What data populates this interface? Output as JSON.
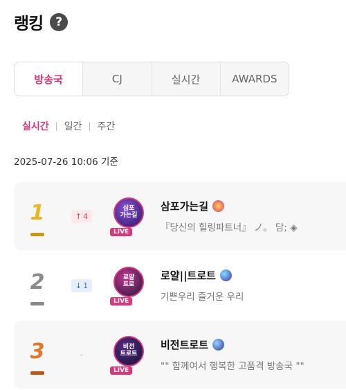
{
  "header": {
    "title": "랭킹",
    "help_icon": "?"
  },
  "tabs": [
    {
      "label": "방송국",
      "active": true
    },
    {
      "label": "CJ",
      "active": false
    },
    {
      "label": "실시간",
      "active": false
    },
    {
      "label": "AWARDS",
      "active": false
    }
  ],
  "period": {
    "realtime": "실시간",
    "daily": "일간",
    "weekly": "주간",
    "separator": "|"
  },
  "timestamp": "2025-07-26 10:06 기준",
  "colors": {
    "accent": "#d7377b",
    "gold": "#e8b723",
    "silver": "#8a8a8a",
    "bronze": "#e07a2a"
  },
  "rankings": [
    {
      "rank": "1",
      "change": "4",
      "change_dir": "up",
      "change_icon": "arrow-up-icon",
      "logo_text": "삼포\n가는길",
      "live": "LIVE",
      "name": "삼포가는길",
      "desc": "『당신의 힐링파트너』 ノ。 담; ◈"
    },
    {
      "rank": "2",
      "change": "1",
      "change_dir": "down",
      "change_icon": "arrow-down-icon",
      "logo_text": "로얄\n트로",
      "live": "LIVE",
      "name": "로얄||트로트",
      "desc": "기쁜우리 즐거운 우리"
    },
    {
      "rank": "3",
      "change": "-",
      "change_dir": "none",
      "change_icon": "",
      "logo_text": "비전\n트로트",
      "live": "LIVE",
      "name": "비전트로트",
      "desc": "\"\" 함께여서 행복한 고품격 방송국 \"\""
    }
  ]
}
